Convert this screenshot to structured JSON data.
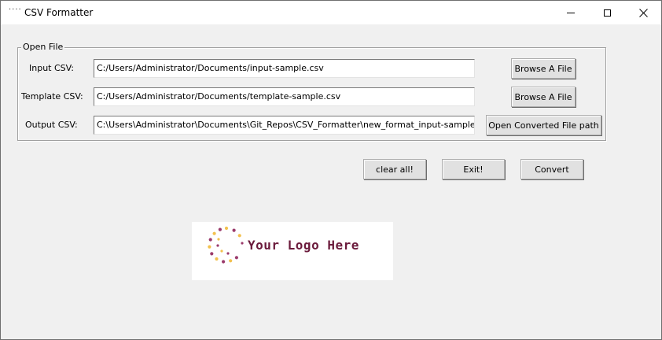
{
  "window": {
    "title": "CSV Formatter",
    "icon": "dots-icon",
    "icon_glyph": "····"
  },
  "group": {
    "legend": "Open File",
    "rows": [
      {
        "label": "Input CSV:",
        "value": "C:/Users/Administrator/Documents/input-sample.csv",
        "button": "Browse A File"
      },
      {
        "label": "Template CSV:",
        "value": "C:/Users/Administrator/Documents/template-sample.csv",
        "button": "Browse A File"
      },
      {
        "label": "Output CSV:",
        "value": "C:\\Users\\Administrator\\Documents\\Git_Repos\\CSV_Formatter\\new_format_input-sample.csv",
        "button": "Open Converted File path"
      }
    ]
  },
  "actions": {
    "clear_label": "clear all!",
    "exit_label": "Exit!",
    "convert_label": "Convert"
  },
  "logo": {
    "text": "Your Logo Here",
    "text_color": "#6b1b3c",
    "dot_colors": [
      "#f2c14e",
      "#9b3b6b"
    ]
  },
  "colors": {
    "window_bg": "#f0f0f0",
    "titlebar_bg": "#ffffff",
    "button_bg": "#e1e1e1"
  }
}
